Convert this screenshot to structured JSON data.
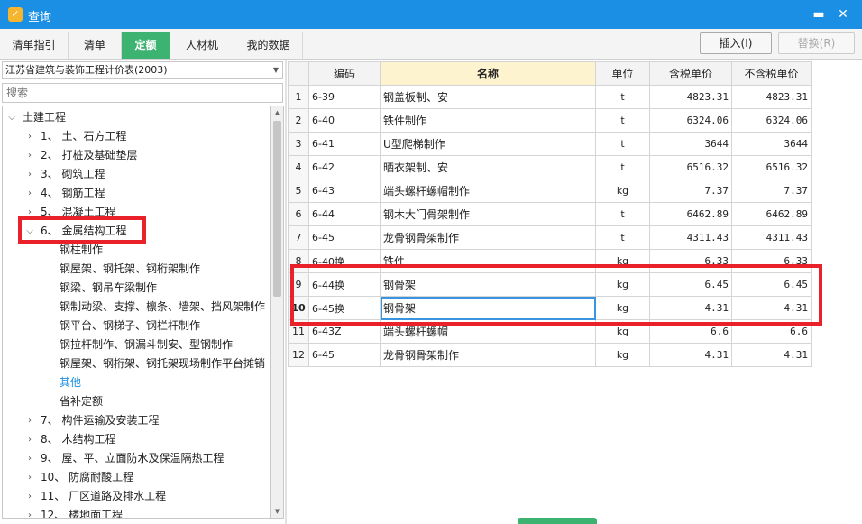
{
  "window": {
    "title": "查询",
    "minimize_glyph": "▬",
    "close_glyph": "✕"
  },
  "tabs": [
    {
      "label": "清单指引"
    },
    {
      "label": "清单"
    },
    {
      "label": "定额",
      "active": true
    },
    {
      "label": "人材机"
    },
    {
      "label": "我的数据"
    }
  ],
  "toolbar": {
    "insert_label": "插入(I)",
    "replace_label": "替换(R)"
  },
  "library": {
    "selected": "江苏省建筑与装饰工程计价表(2003)"
  },
  "search": {
    "placeholder": "搜索"
  },
  "tree": {
    "root": "土建工程",
    "items": [
      "1、 土、石方工程",
      "2、 打桩及基础垫层",
      "3、 砌筑工程",
      "4、 钢筋工程",
      "5、 混凝土工程",
      "6、 金属结构工程",
      "钢柱制作",
      "钢屋架、钢托架、钢桁架制作",
      "钢梁、钢吊车梁制作",
      "钢制动梁、支撑、檩条、墙架、挡风架制作",
      "钢平台、钢梯子、钢栏杆制作",
      "钢拉杆制作、钢漏斗制安、型钢制作",
      "钢屋架、钢桁架、钢托架现场制作平台摊销",
      "其他",
      "省补定额",
      "7、 构件运输及安装工程",
      "8、 木结构工程",
      "9、 屋、平、立面防水及保温隔热工程",
      "10、 防腐耐酸工程",
      "11、 厂区道路及排水工程",
      "12、 楼地面工程"
    ]
  },
  "grid": {
    "columns": [
      "编码",
      "名称",
      "单位",
      "含税单价",
      "不含税单价"
    ],
    "rows": [
      {
        "idx": "1",
        "code": "6-39",
        "name": "钢盖板制、安",
        "unit": "t",
        "price_tax": "4823.31",
        "price_notax": "4823.31"
      },
      {
        "idx": "2",
        "code": "6-40",
        "name": "铁件制作",
        "unit": "t",
        "price_tax": "6324.06",
        "price_notax": "6324.06"
      },
      {
        "idx": "3",
        "code": "6-41",
        "name": "U型爬梯制作",
        "unit": "t",
        "price_tax": "3644",
        "price_notax": "3644"
      },
      {
        "idx": "4",
        "code": "6-42",
        "name": "晒衣架制、安",
        "unit": "t",
        "price_tax": "6516.32",
        "price_notax": "6516.32"
      },
      {
        "idx": "5",
        "code": "6-43",
        "name": "端头螺杆螺帽制作",
        "unit": "kg",
        "price_tax": "7.37",
        "price_notax": "7.37"
      },
      {
        "idx": "6",
        "code": "6-44",
        "name": "钢木大门骨架制作",
        "unit": "t",
        "price_tax": "6462.89",
        "price_notax": "6462.89"
      },
      {
        "idx": "7",
        "code": "6-45",
        "name": "龙骨钢骨架制作",
        "unit": "t",
        "price_tax": "4311.43",
        "price_notax": "4311.43"
      },
      {
        "idx": "8",
        "code": "6-40换",
        "name": "铁件",
        "unit": "kg",
        "price_tax": "6.33",
        "price_notax": "6.33"
      },
      {
        "idx": "9",
        "code": "6-44换",
        "name": "钢骨架",
        "unit": "kg",
        "price_tax": "6.45",
        "price_notax": "6.45"
      },
      {
        "idx": "10",
        "code": "6-45换",
        "name": "钢骨架",
        "unit": "kg",
        "price_tax": "4.31",
        "price_notax": "4.31"
      },
      {
        "idx": "11",
        "code": "6-43Z",
        "name": "端头螺杆螺帽",
        "unit": "kg",
        "price_tax": "6.6",
        "price_notax": "6.6"
      },
      {
        "idx": "12",
        "code": "6-45",
        "name": "龙骨钢骨架制作",
        "unit": "kg",
        "price_tax": "4.31",
        "price_notax": "4.31"
      }
    ]
  },
  "colors": {
    "titlebar": "#1a8fe3",
    "active_tab": "#3cb371",
    "highlight": "#e8212b",
    "link": "#1a8fe3"
  }
}
